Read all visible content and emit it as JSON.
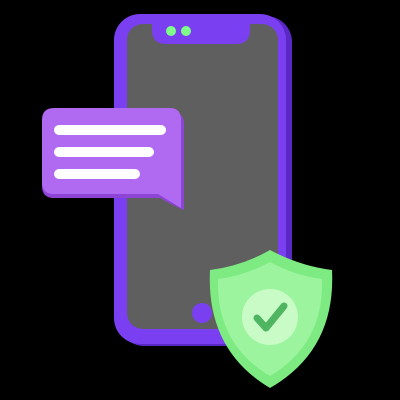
{
  "illustration": {
    "icons": [
      "smartphone-icon",
      "chat-bubble-icon",
      "shield-check-icon"
    ],
    "colors": {
      "background": "#000000",
      "phone_body": "#7a3ff0",
      "phone_body_dark": "#5a28c4",
      "phone_screen": "#5f5f5f",
      "camera_dots": "#7dff8a",
      "bubble": "#b06af2",
      "bubble_shade": "#8e45d6",
      "bubble_lines": "#ffffff",
      "shield_outer": "#7eea82",
      "shield_inner": "#9cf59e",
      "check_circle": "#c9fbc6",
      "check_mark": "#4fb561"
    }
  }
}
